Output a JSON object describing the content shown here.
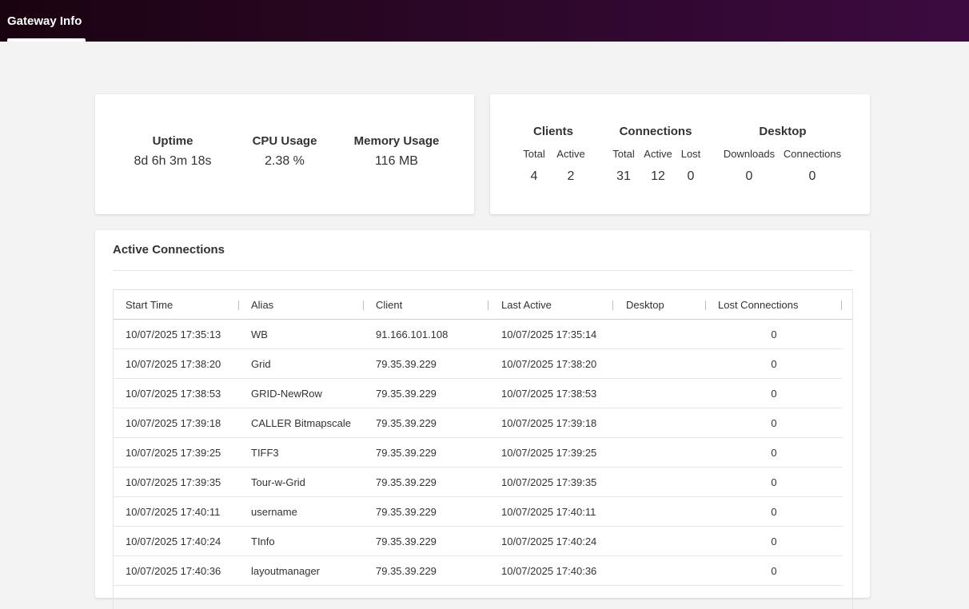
{
  "header": {
    "tab_label": "Gateway Info"
  },
  "stats": {
    "uptime": {
      "label": "Uptime",
      "value": "8d 6h 3m 18s"
    },
    "cpu": {
      "label": "CPU Usage",
      "value": "2.38 %"
    },
    "memory": {
      "label": "Memory Usage",
      "value": "116 MB"
    }
  },
  "counts": {
    "clients": {
      "title": "Clients",
      "total_label": "Total",
      "active_label": "Active",
      "total": "4",
      "active": "2"
    },
    "connections": {
      "title": "Connections",
      "total_label": "Total",
      "active_label": "Active",
      "lost_label": "Lost",
      "total": "31",
      "active": "12",
      "lost": "0"
    },
    "desktop": {
      "title": "Desktop",
      "downloads_label": "Downloads",
      "connections_label": "Connections",
      "downloads": "0",
      "connections": "0"
    }
  },
  "active_connections": {
    "title": "Active Connections",
    "columns": [
      "Start Time",
      "Alias",
      "Client",
      "Last Active",
      "Desktop",
      "Lost Connections"
    ],
    "rows": [
      [
        "10/07/2025 17:35:13",
        "WB",
        "91.166.101.108",
        "10/07/2025 17:35:14",
        "",
        "0"
      ],
      [
        "10/07/2025 17:38:20",
        "Grid",
        "79.35.39.229",
        "10/07/2025 17:38:20",
        "",
        "0"
      ],
      [
        "10/07/2025 17:38:53",
        "GRID-NewRow",
        "79.35.39.229",
        "10/07/2025 17:38:53",
        "",
        "0"
      ],
      [
        "10/07/2025 17:39:18",
        "CALLER Bitmapscale",
        "79.35.39.229",
        "10/07/2025 17:39:18",
        "",
        "0"
      ],
      [
        "10/07/2025 17:39:25",
        "TIFF3",
        "79.35.39.229",
        "10/07/2025 17:39:25",
        "",
        "0"
      ],
      [
        "10/07/2025 17:39:35",
        "Tour-w-Grid",
        "79.35.39.229",
        "10/07/2025 17:39:35",
        "",
        "0"
      ],
      [
        "10/07/2025 17:40:11",
        "username",
        "79.35.39.229",
        "10/07/2025 17:40:11",
        "",
        "0"
      ],
      [
        "10/07/2025 17:40:24",
        "TInfo",
        "79.35.39.229",
        "10/07/2025 17:40:24",
        "",
        "0"
      ],
      [
        "10/07/2025 17:40:36",
        "layoutmanager",
        "79.35.39.229",
        "10/07/2025 17:40:36",
        "",
        "0"
      ]
    ]
  }
}
